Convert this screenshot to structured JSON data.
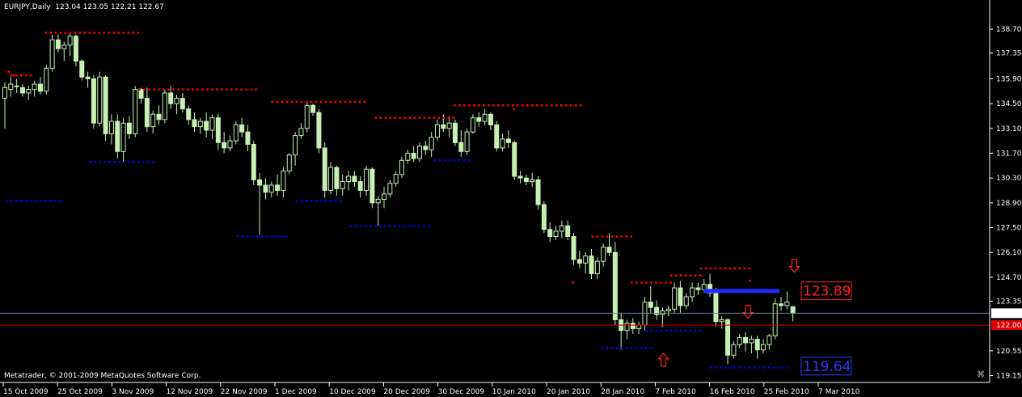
{
  "header": {
    "symbol": "EURJPY,Daily",
    "ohlc": "123.04 123.05 122.21 122.67"
  },
  "footer": {
    "copyright": "Metatrader, © 2001-2009 MetaQuotes Software Corp."
  },
  "colors": {
    "background": "#000000",
    "candle": "#c8f0b4",
    "resistance_dots": "#ff0000",
    "support_dots": "#0000ff",
    "bid_line": "#6a7fa0",
    "ask_line": "#c00000",
    "grid_text": "#ffffff"
  },
  "chart_data": {
    "type": "candlestick",
    "y_ticks": [
      "138.70",
      "137.35",
      "135.90",
      "134.50",
      "133.10",
      "131.70",
      "130.30",
      "128.90",
      "127.50",
      "126.10",
      "124.70",
      "123.35",
      "120.55",
      "119.15"
    ],
    "ylim": [
      118.9,
      139.8
    ],
    "x_ticks": [
      "15 Oct 2009",
      "25 Oct 2009",
      "3 Nov 2009",
      "12 Nov 2009",
      "22 Nov 2009",
      "1 Dec 2009",
      "10 Dec 2009",
      "20 Dec 2009",
      "30 Dec 2009",
      "10 Jan 2010",
      "20 Jan 2010",
      "28 Jan 2010",
      "7 Feb 2010",
      "16 Feb 2010",
      "25 Feb 2010",
      "7 Mar 2010"
    ],
    "bid": {
      "label": "122.67",
      "value": 122.67
    },
    "ask": {
      "label": "122.00",
      "value": 122.0
    },
    "resistance_label": {
      "text": "123.89",
      "value": 123.89
    },
    "support_label": {
      "text": "119.64",
      "value": 119.64
    },
    "candles": [
      [
        134.8,
        135.7,
        133.1,
        135.4
      ],
      [
        135.3,
        136.0,
        134.9,
        135.6
      ],
      [
        135.5,
        135.9,
        135.1,
        135.5
      ],
      [
        135.4,
        135.6,
        134.9,
        135.1
      ],
      [
        135.1,
        135.5,
        134.7,
        135.3
      ],
      [
        135.3,
        135.8,
        134.9,
        135.6
      ],
      [
        135.6,
        136.0,
        135.0,
        135.2
      ],
      [
        135.2,
        136.7,
        135.0,
        136.5
      ],
      [
        136.5,
        138.4,
        136.3,
        138.1
      ],
      [
        138.1,
        138.4,
        137.4,
        137.6
      ],
      [
        137.6,
        138.0,
        136.9,
        137.8
      ],
      [
        137.8,
        138.5,
        137.2,
        138.3
      ],
      [
        138.3,
        138.4,
        136.6,
        136.9
      ],
      [
        136.9,
        137.0,
        135.8,
        136.0
      ],
      [
        136.0,
        136.3,
        135.4,
        135.9
      ],
      [
        135.9,
        136.1,
        133.1,
        133.4
      ],
      [
        133.4,
        136.3,
        133.2,
        136.0
      ],
      [
        136.0,
        136.1,
        132.4,
        132.8
      ],
      [
        132.8,
        133.9,
        132.2,
        133.5
      ],
      [
        133.5,
        133.9,
        131.4,
        131.8
      ],
      [
        131.8,
        133.7,
        131.2,
        133.4
      ],
      [
        133.4,
        133.8,
        132.5,
        132.8
      ],
      [
        132.8,
        135.5,
        132.6,
        135.3
      ],
      [
        135.3,
        135.4,
        134.5,
        134.8
      ],
      [
        134.8,
        135.4,
        132.9,
        133.2
      ],
      [
        133.2,
        134.1,
        132.8,
        133.9
      ],
      [
        133.9,
        134.4,
        133.3,
        133.6
      ],
      [
        133.6,
        135.3,
        133.4,
        135.1
      ],
      [
        135.1,
        135.5,
        134.2,
        134.5
      ],
      [
        134.5,
        135.0,
        133.9,
        134.8
      ],
      [
        134.8,
        135.1,
        134.0,
        134.2
      ],
      [
        134.2,
        134.4,
        133.3,
        133.6
      ],
      [
        133.6,
        134.0,
        132.9,
        133.2
      ],
      [
        133.2,
        133.7,
        132.8,
        133.5
      ],
      [
        133.5,
        134.0,
        132.6,
        133.0
      ],
      [
        133.0,
        133.9,
        132.5,
        133.7
      ],
      [
        133.7,
        133.9,
        131.9,
        132.3
      ],
      [
        132.3,
        132.9,
        131.7,
        132.0
      ],
      [
        132.0,
        132.7,
        131.8,
        132.4
      ],
      [
        132.4,
        133.5,
        132.2,
        133.3
      ],
      [
        133.3,
        133.7,
        132.6,
        132.9
      ],
      [
        132.9,
        133.3,
        131.8,
        132.2
      ],
      [
        132.2,
        132.4,
        129.9,
        130.2
      ],
      [
        130.2,
        130.6,
        127.1,
        129.9
      ],
      [
        129.9,
        130.3,
        129.1,
        129.5
      ],
      [
        129.5,
        130.1,
        129.2,
        129.9
      ],
      [
        129.9,
        130.5,
        129.3,
        129.6
      ],
      [
        129.6,
        130.9,
        129.2,
        130.7
      ],
      [
        130.7,
        131.7,
        130.5,
        131.6
      ],
      [
        131.6,
        132.9,
        131.0,
        132.7
      ],
      [
        132.7,
        133.4,
        132.5,
        133.1
      ],
      [
        133.1,
        134.6,
        132.9,
        134.4
      ],
      [
        134.4,
        134.5,
        133.8,
        134.0
      ],
      [
        134.0,
        134.2,
        131.7,
        132.0
      ],
      [
        132.0,
        132.3,
        129.2,
        129.6
      ],
      [
        129.6,
        131.2,
        129.4,
        130.9
      ],
      [
        130.9,
        131.0,
        129.3,
        129.7
      ],
      [
        129.7,
        130.5,
        129.3,
        130.1
      ],
      [
        130.1,
        130.7,
        129.6,
        130.4
      ],
      [
        130.4,
        130.7,
        129.8,
        130.1
      ],
      [
        130.1,
        130.4,
        129.2,
        129.6
      ],
      [
        129.6,
        131.0,
        129.3,
        130.8
      ],
      [
        130.8,
        130.9,
        128.6,
        128.9
      ],
      [
        128.9,
        129.3,
        127.6,
        129.1
      ],
      [
        129.1,
        129.8,
        128.6,
        129.4
      ],
      [
        129.4,
        130.2,
        129.2,
        130.0
      ],
      [
        130.0,
        130.7,
        129.8,
        130.5
      ],
      [
        130.5,
        131.5,
        130.3,
        131.3
      ],
      [
        131.3,
        131.9,
        131.1,
        131.7
      ],
      [
        131.7,
        132.1,
        131.2,
        131.4
      ],
      [
        131.4,
        132.3,
        131.2,
        132.1
      ],
      [
        132.1,
        132.4,
        131.6,
        131.9
      ],
      [
        131.9,
        132.9,
        131.5,
        132.6
      ],
      [
        132.6,
        133.6,
        132.4,
        133.3
      ],
      [
        133.3,
        133.9,
        132.9,
        133.1
      ],
      [
        133.1,
        133.8,
        132.6,
        133.4
      ],
      [
        133.4,
        133.6,
        132.1,
        132.3
      ],
      [
        132.3,
        133.0,
        131.5,
        131.8
      ],
      [
        131.8,
        133.1,
        131.6,
        132.9
      ],
      [
        132.9,
        133.9,
        132.8,
        133.7
      ],
      [
        133.7,
        134.0,
        133.2,
        133.5
      ],
      [
        133.5,
        134.2,
        133.3,
        133.9
      ],
      [
        133.9,
        134.0,
        133.0,
        133.3
      ],
      [
        133.3,
        133.5,
        131.8,
        132.0
      ],
      [
        132.0,
        132.8,
        131.8,
        132.5
      ],
      [
        132.5,
        133.0,
        132.0,
        132.3
      ],
      [
        132.3,
        132.4,
        130.2,
        130.4
      ],
      [
        130.4,
        130.7,
        130.0,
        130.3
      ],
      [
        130.3,
        130.5,
        129.9,
        130.1
      ],
      [
        130.1,
        130.6,
        129.8,
        130.2
      ],
      [
        130.2,
        130.4,
        128.5,
        128.8
      ],
      [
        128.8,
        129.0,
        127.2,
        127.4
      ],
      [
        127.4,
        127.8,
        126.7,
        127.0
      ],
      [
        127.0,
        127.6,
        126.8,
        127.3
      ],
      [
        127.3,
        127.9,
        126.9,
        127.6
      ],
      [
        127.6,
        127.9,
        126.8,
        127.0
      ],
      [
        127.0,
        127.2,
        125.4,
        125.7
      ],
      [
        125.7,
        126.2,
        125.2,
        125.5
      ],
      [
        125.5,
        126.1,
        124.9,
        125.9
      ],
      [
        125.9,
        126.3,
        124.6,
        124.9
      ],
      [
        124.9,
        125.8,
        124.6,
        125.6
      ],
      [
        125.6,
        126.6,
        125.3,
        126.4
      ],
      [
        126.4,
        127.2,
        125.9,
        126.1
      ],
      [
        126.1,
        126.7,
        122.0,
        122.3
      ],
      [
        122.3,
        122.7,
        120.6,
        121.7
      ],
      [
        121.7,
        122.3,
        121.2,
        122.1
      ],
      [
        122.1,
        122.4,
        121.5,
        121.8
      ],
      [
        121.8,
        122.2,
        121.5,
        122.0
      ],
      [
        122.0,
        123.6,
        121.7,
        123.3
      ],
      [
        123.3,
        124.2,
        122.7,
        123.0
      ],
      [
        123.0,
        123.4,
        122.3,
        122.6
      ],
      [
        122.6,
        123.0,
        121.9,
        122.8
      ],
      [
        122.8,
        123.1,
        122.5,
        122.9
      ],
      [
        122.9,
        124.4,
        122.7,
        124.1
      ],
      [
        124.1,
        124.5,
        122.7,
        123.1
      ],
      [
        123.1,
        123.8,
        122.9,
        123.6
      ],
      [
        123.6,
        124.4,
        123.3,
        124.1
      ],
      [
        124.1,
        124.4,
        123.7,
        124.0
      ],
      [
        124.0,
        124.6,
        123.8,
        124.3
      ],
      [
        124.3,
        124.9,
        123.6,
        123.8
      ],
      [
        123.8,
        124.1,
        121.9,
        122.2
      ],
      [
        122.2,
        122.5,
        121.8,
        122.3
      ],
      [
        122.3,
        122.4,
        119.8,
        120.3
      ],
      [
        120.3,
        121.1,
        120.1,
        120.9
      ],
      [
        120.9,
        121.5,
        120.7,
        121.3
      ],
      [
        121.3,
        121.6,
        120.5,
        121.0
      ],
      [
        121.0,
        121.4,
        120.4,
        121.2
      ],
      [
        121.2,
        121.4,
        120.1,
        120.6
      ],
      [
        120.6,
        121.2,
        120.4,
        120.9
      ],
      [
        120.9,
        121.5,
        120.6,
        121.4
      ],
      [
        121.4,
        123.5,
        121.2,
        123.2
      ],
      [
        123.2,
        123.6,
        122.8,
        123.1
      ],
      [
        123.1,
        123.9,
        122.9,
        123.3
      ],
      [
        123.04,
        123.05,
        122.21,
        122.67
      ]
    ],
    "resistance_levels": [
      {
        "x1": 0.01,
        "x2": 0.03,
        "y": 136.1
      },
      {
        "x1": 0.045,
        "x2": 0.14,
        "y": 138.5
      },
      {
        "x1": 0.14,
        "x2": 0.26,
        "y": 135.3
      },
      {
        "x1": 0.275,
        "x2": 0.37,
        "y": 134.6
      },
      {
        "x1": 0.38,
        "x2": 0.46,
        "y": 133.7
      },
      {
        "x1": 0.46,
        "x2": 0.59,
        "y": 134.4
      },
      {
        "x1": 0.6,
        "x2": 0.64,
        "y": 127.0
      },
      {
        "x1": 0.64,
        "x2": 0.68,
        "y": 124.4
      },
      {
        "x1": 0.68,
        "x2": 0.71,
        "y": 124.8
      },
      {
        "x1": 0.71,
        "x2": 0.76,
        "y": 125.2
      }
    ],
    "support_levels": [
      {
        "x1": 0.005,
        "x2": 0.06,
        "y": 129.0
      },
      {
        "x1": 0.09,
        "x2": 0.155,
        "y": 131.2
      },
      {
        "x1": 0.24,
        "x2": 0.29,
        "y": 127.0
      },
      {
        "x1": 0.3,
        "x2": 0.345,
        "y": 129.0
      },
      {
        "x1": 0.355,
        "x2": 0.435,
        "y": 127.6
      },
      {
        "x1": 0.44,
        "x2": 0.475,
        "y": 131.3
      },
      {
        "x1": 0.61,
        "x2": 0.66,
        "y": 120.7
      },
      {
        "x1": 0.655,
        "x2": 0.71,
        "y": 121.7
      },
      {
        "x1": 0.72,
        "x2": 0.8,
        "y": 119.6
      }
    ],
    "upper_stops": [
      [
        0.007,
        136.3
      ],
      [
        0.012,
        136.1
      ],
      [
        0.52,
        134.2
      ],
      [
        0.58,
        124.4
      ],
      [
        0.76,
        124.5
      ]
    ],
    "arrows": [
      {
        "dir": "up",
        "color": "red",
        "at": 0.672,
        "y": 120.0
      },
      {
        "dir": "down",
        "color": "red",
        "at": 0.758,
        "y": 122.8
      },
      {
        "dir": "down",
        "color": "red",
        "at": 0.805,
        "y": 125.4
      }
    ],
    "support_bar": {
      "x1": 0.713,
      "x2": 0.79,
      "y": 123.9
    }
  }
}
